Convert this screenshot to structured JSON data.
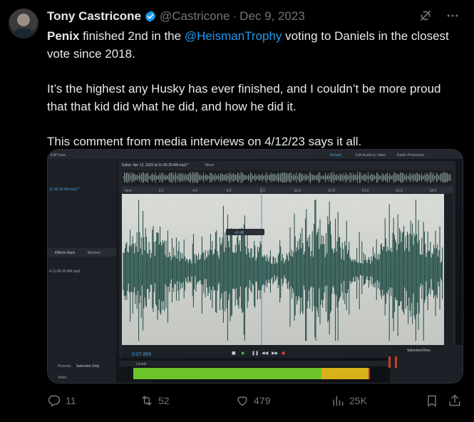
{
  "tweet": {
    "author_name": "Tony Castricone",
    "handle": "@Castricone",
    "separator": "·",
    "date": "Dec 9, 2023",
    "paragraph1": {
      "bold": "Penix",
      "pre": " finished 2nd in the ",
      "mention": "@HeismanTrophy",
      "post": " voting to Daniels in the closest vote since 2018."
    },
    "paragraph2": "It’s the highest any Husky has ever finished, and I couldn’t be more proud that that kid did what he did, and how he did it.",
    "paragraph3": "This comment from media interviews on 4/12/23 says it all."
  },
  "media": {
    "editor_tab": "Editor: Apr 12, 2023 at 11-06-39 AM.mp3 *",
    "mixer_tab": "Mixer",
    "default_label": "Default",
    "edit_audio_label": "Edit Audio to Video",
    "radio_label": "Radio Production",
    "file_label": "11-06-39 AM.mp3 *",
    "effects_tab": "Effects Rack",
    "markers_tab": "Markers",
    "effects_file": "4 11-06-39 AM.mp3",
    "time_display": "0:07.866",
    "levels_label": "Levels",
    "selection_label": "Selection/View",
    "process_label": "Process:",
    "selection_only": "Selection Only",
    "video_label": "Video",
    "edit_track": "EditTrack",
    "ruler_ticks": [
      "hms",
      "2.0",
      "4.0",
      "6.0",
      "8.0",
      "10.0",
      "12.0",
      "14.0",
      "16.0",
      "18.0"
    ],
    "gain_label": "+0 dB"
  },
  "actions": {
    "replies": "11",
    "reposts": "52",
    "likes": "479",
    "views": "25K"
  },
  "colors": {
    "accent": "#1d9bf0",
    "muted": "#71767b",
    "waveform": "#1f4a44",
    "meter_green": "#6cc42a",
    "meter_yellow": "#d8b21a"
  }
}
